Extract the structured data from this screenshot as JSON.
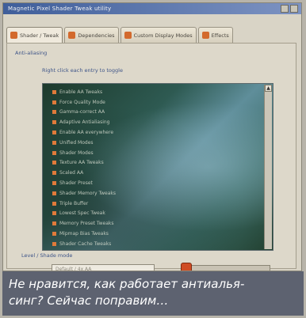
{
  "window": {
    "title": "Magnetic Pixel Shader Tweak utility",
    "tabs": [
      {
        "label": "Shader / Tweak",
        "active": true
      },
      {
        "label": "Dependencies",
        "active": false
      },
      {
        "label": "Custom Display Modes",
        "active": false
      },
      {
        "label": "Effects",
        "active": false
      }
    ]
  },
  "panel": {
    "group_label": "Anti-aliasing",
    "sub_label": "Right click each entry to toggle",
    "list_items": [
      "Enable AA Tweaks",
      "Force Quality Mode",
      "Gamma-correct AA",
      "Adaptive Antialiasing",
      "Enable AA everywhere",
      "Unified Modes",
      "Shader Modes",
      "Texture AA Tweaks",
      "Scaled AA",
      "Shader Preset",
      "Shader Memory Tweaks",
      "Triple Buffer",
      "Lowest Spec Tweak",
      "Memory Preset Tweaks",
      "Mipmap Bias Tweaks",
      "Shader Cache Tweaks"
    ],
    "field_label": "Level / Shade mode",
    "field_value": "Default / 4x AA",
    "slider_value": 0.0
  },
  "caption": {
    "line1": "Не нравится, как работает антиалья-",
    "line2": "синг? Сейчас поправим…"
  },
  "colors": {
    "caption_bg": "#5d6270",
    "accent_orange": "#d36a2d",
    "titlebar": "#3f5e9a"
  }
}
